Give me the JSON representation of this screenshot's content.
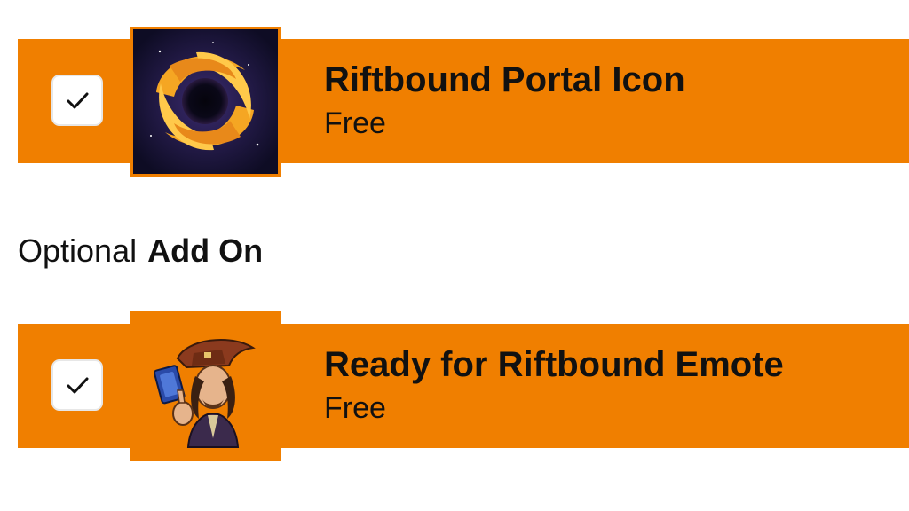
{
  "items": [
    {
      "title": "Riftbound Portal Icon",
      "price": "Free",
      "checked": true,
      "thumbnail": "riftbound-portal-icon-art"
    },
    {
      "title": "Ready for Riftbound Emote",
      "price": "Free",
      "checked": true,
      "thumbnail": "riftbound-emote-art"
    }
  ],
  "addon_section": {
    "label_regular": "Optional",
    "label_bold": "Add On"
  },
  "colors": {
    "accent": "#f07f00",
    "text": "#111111",
    "checkbox_bg": "#ffffff"
  }
}
